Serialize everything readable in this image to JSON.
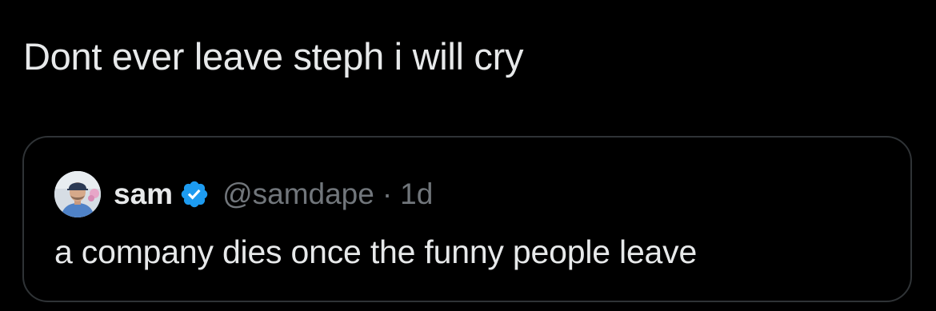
{
  "tweet": {
    "text": "Dont ever leave steph i will cry"
  },
  "quoted_tweet": {
    "author_name": "sam",
    "handle": "@samdape",
    "separator": "·",
    "timestamp": "1d",
    "verified": true,
    "verified_badge_color": "#1d9bf0",
    "text": "a company dies once the funny people leave"
  },
  "colors": {
    "background": "#000000",
    "primary_text": "#e7e9ea",
    "secondary_text": "#71767b",
    "border": "#2f3336"
  }
}
